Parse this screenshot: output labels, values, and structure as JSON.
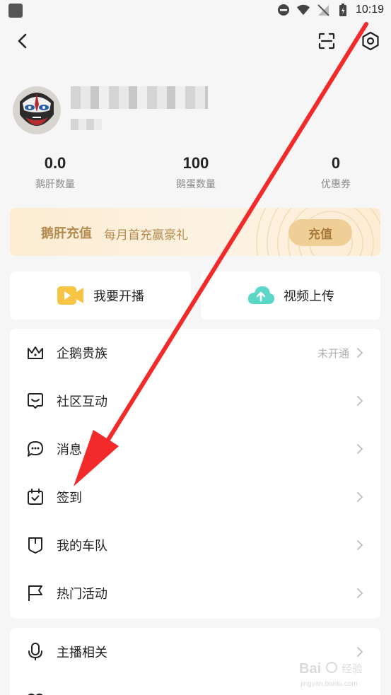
{
  "status_bar": {
    "time": "10:19"
  },
  "stats": [
    {
      "value": "0.0",
      "label": "鹅肝数量"
    },
    {
      "value": "100",
      "label": "鹅蛋数量"
    },
    {
      "value": "0",
      "label": "优惠券"
    }
  ],
  "recharge": {
    "title": "鹅肝充值",
    "subtitle": "每月首充赢豪礼",
    "button": "充值"
  },
  "actions": {
    "live": "我要开播",
    "upload": "视频上传"
  },
  "menu": [
    {
      "label": "企鹅贵族",
      "extra": "未开通",
      "icon": "crown-icon"
    },
    {
      "label": "社区互动",
      "extra": "",
      "icon": "community-chat-icon"
    },
    {
      "label": "消息",
      "extra": "",
      "icon": "message-bubble-icon"
    },
    {
      "label": "签到",
      "extra": "",
      "icon": "calendar-check-icon"
    },
    {
      "label": "我的车队",
      "extra": "",
      "icon": "shield-icon"
    },
    {
      "label": "热门活动",
      "extra": "",
      "icon": "flag-icon"
    }
  ],
  "menu2": [
    {
      "label": "主播相关",
      "icon": "microphone-icon"
    }
  ],
  "watermark": {
    "brand": "Bai",
    "site": "jingyan.baidu.com",
    "label": "经验"
  },
  "colors": {
    "annotation_arrow": "#f22a2a",
    "recharge_gold": "#b58a4e",
    "recharge_button": "#f0cf96",
    "live_icon": "#f7c443",
    "upload_icon": "#5ad7c7"
  }
}
